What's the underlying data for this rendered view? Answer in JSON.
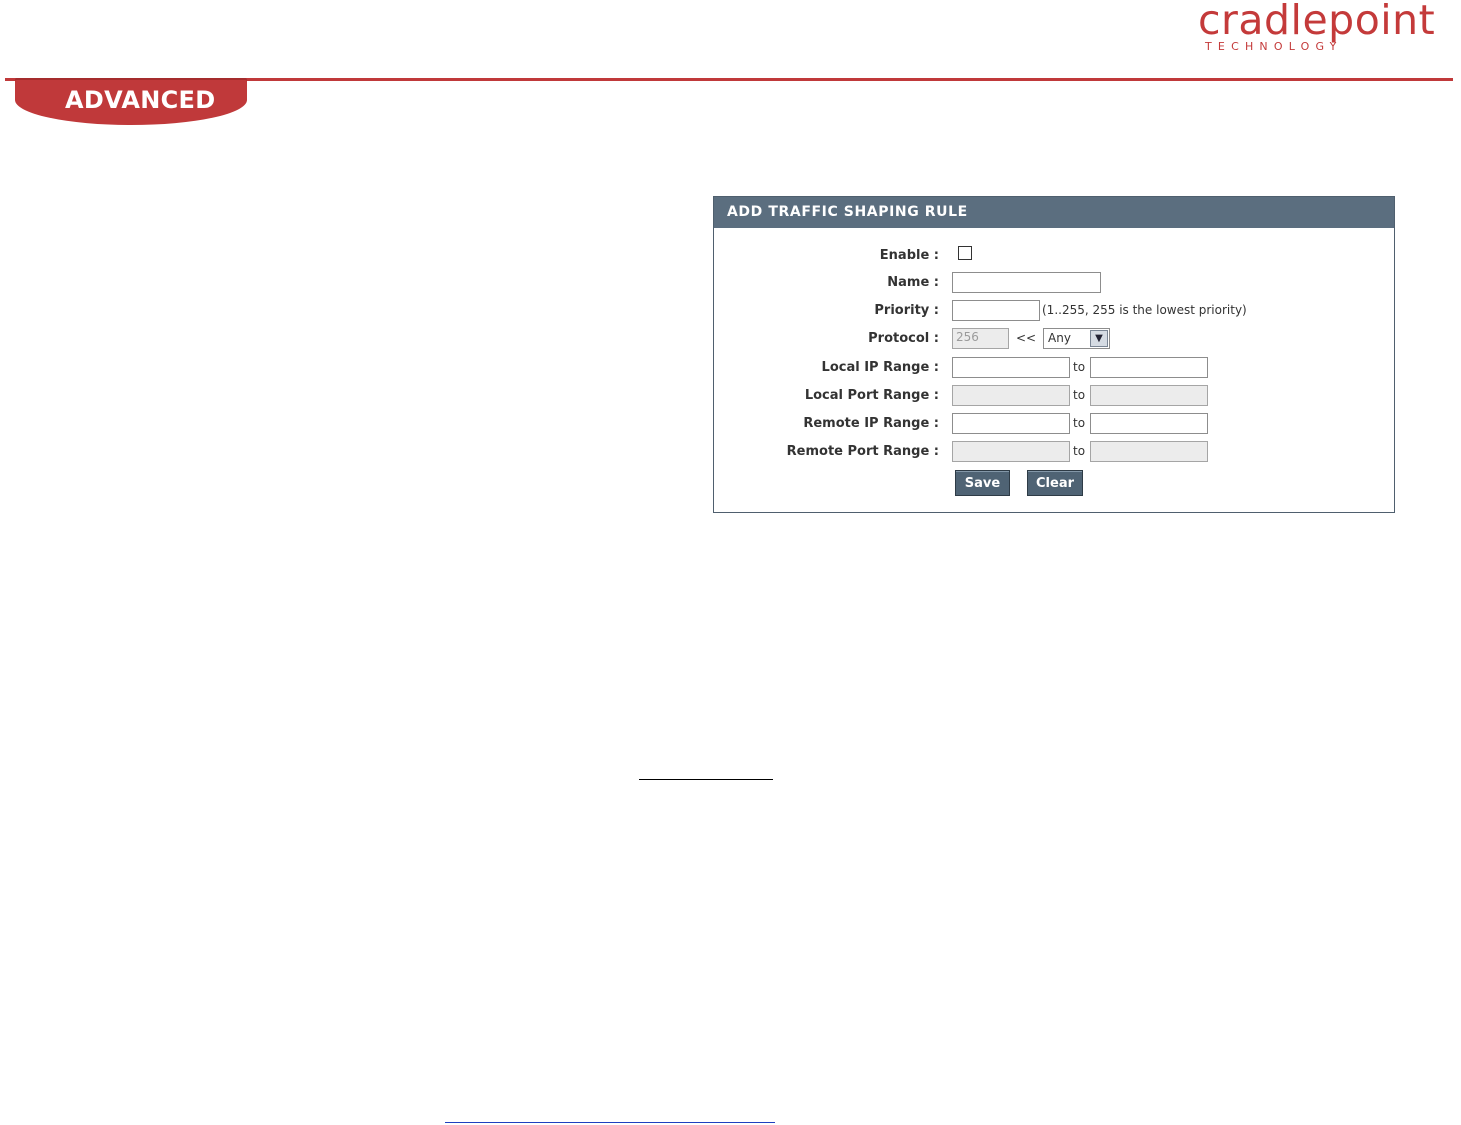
{
  "header": {
    "brand_name": "cradlepoint",
    "brand_sub": "TECHNOLOGY",
    "section_tab": "ADVANCED",
    "accent_color": "#c0393a"
  },
  "form": {
    "title": "ADD TRAFFIC SHAPING RULE",
    "fields": {
      "enable_label": "Enable :",
      "name_label": "Name :",
      "name_value": "",
      "priority_label": "Priority :",
      "priority_value": "",
      "priority_note": "(1..255, 255 is the lowest priority)",
      "protocol_label": "Protocol :",
      "protocol_value": "256",
      "protocol_arrows": "<<",
      "protocol_select": "Any",
      "local_ip_label": "Local IP Range :",
      "local_port_label": "Local Port Range :",
      "remote_ip_label": "Remote IP Range :",
      "remote_port_label": "Remote Port Range :",
      "to": "to"
    },
    "buttons": {
      "save": "Save",
      "clear": "Clear"
    },
    "enabled": false
  }
}
